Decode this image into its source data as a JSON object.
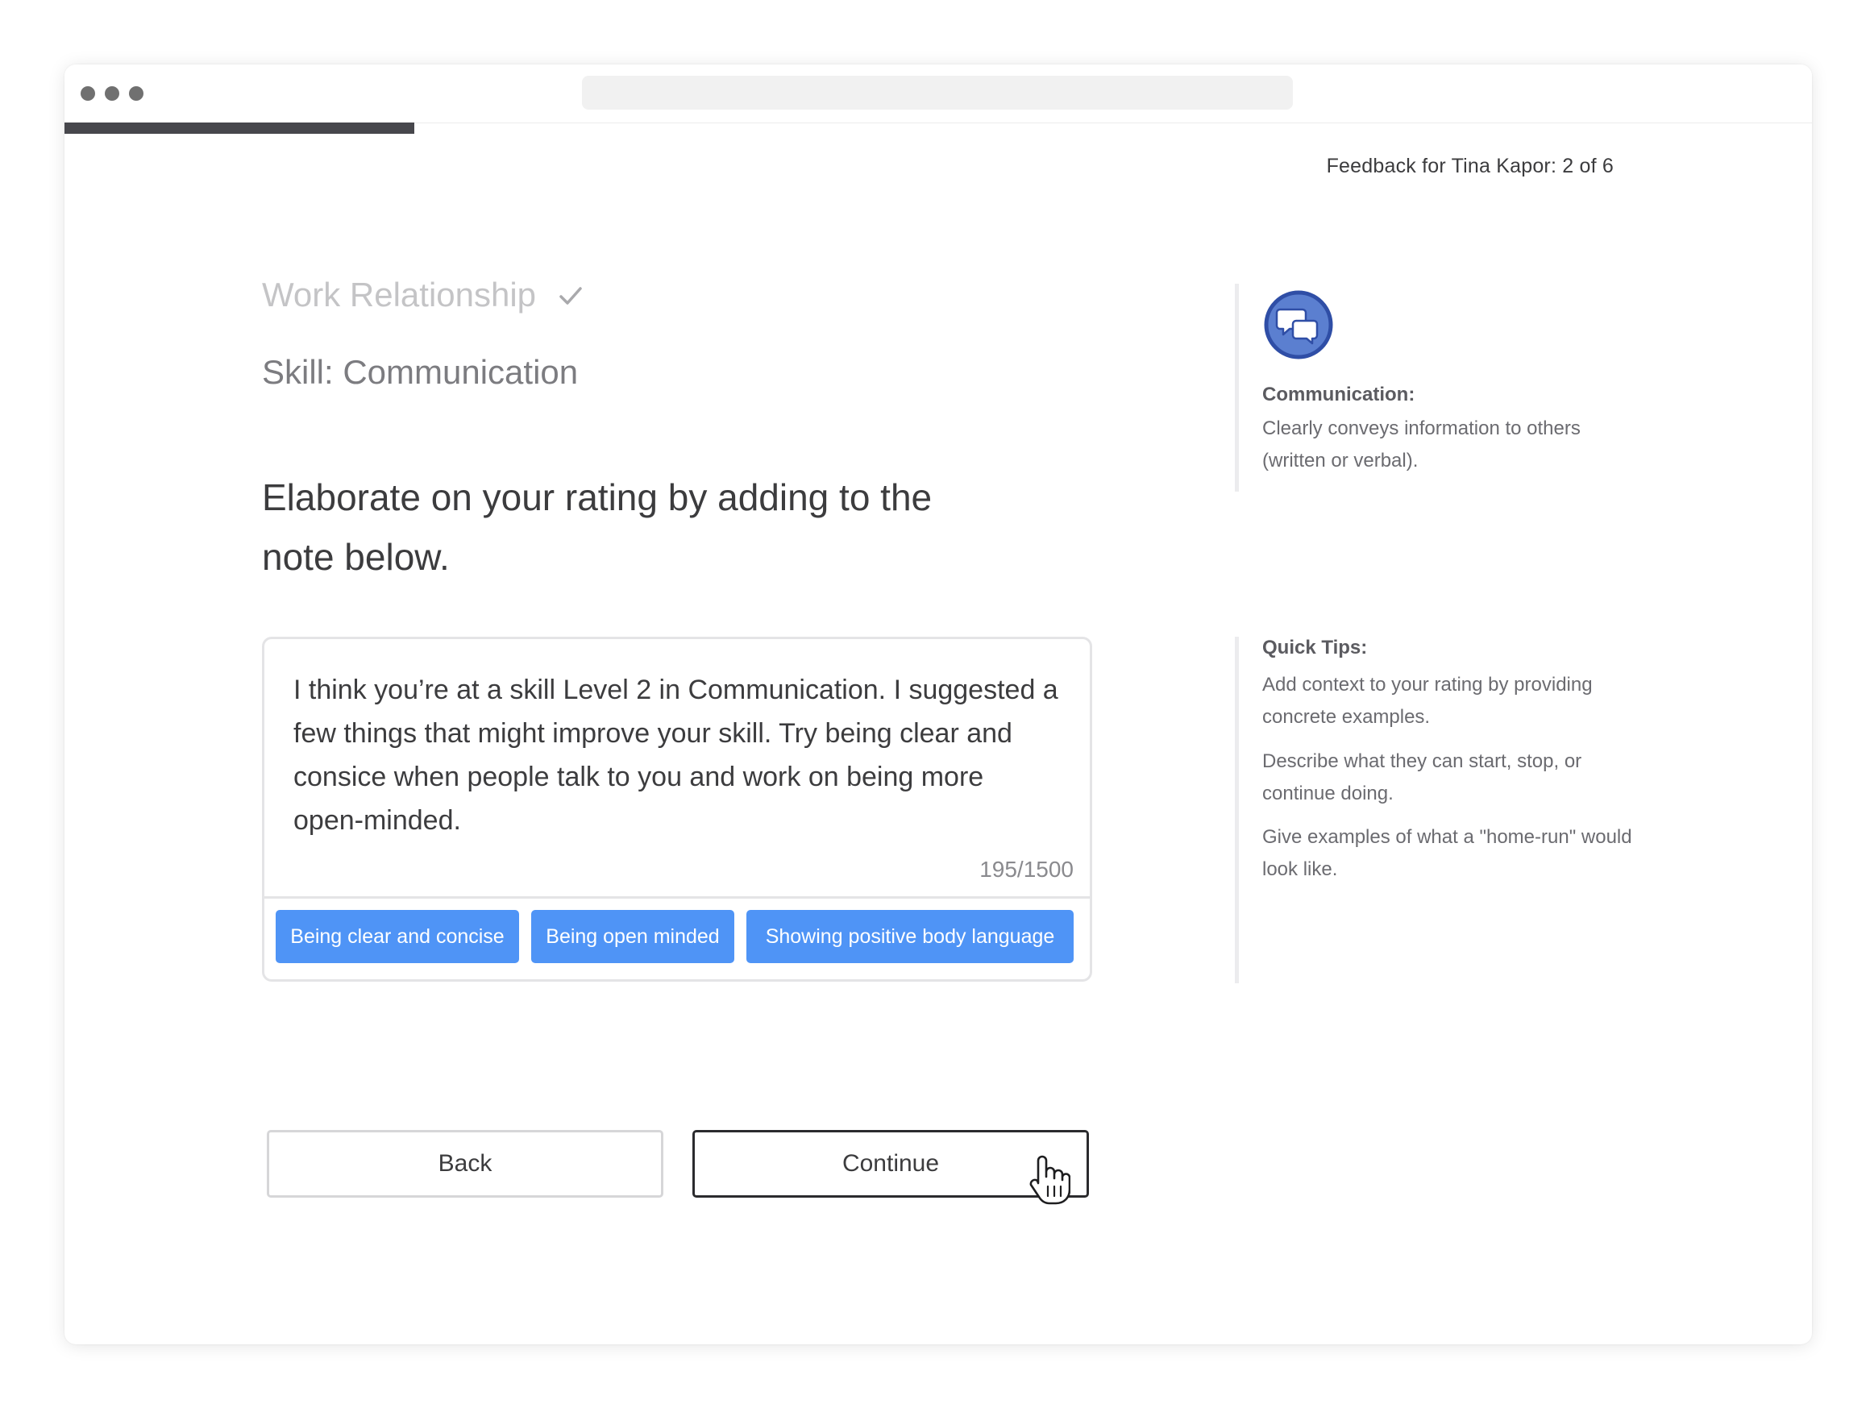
{
  "window": {
    "controls": [
      "window-dot",
      "window-dot",
      "window-dot"
    ]
  },
  "progress": {
    "value": 0.2
  },
  "header": {
    "feedback_counter": "Feedback for Tina Kapor: 2 of 6"
  },
  "main": {
    "section_title": "Work Relationship",
    "skill_label": "Skill: Communication",
    "prompt": "Elaborate on your rating by adding to the note below.",
    "note": {
      "text": "I think you’re at a skill Level 2 in Communication. I suggested a few things that might improve your skill. Try being clear and consice when people talk to you and work on being more open-minded.",
      "char_count": "195/1500"
    },
    "chips": [
      {
        "label": "Being clear and concise"
      },
      {
        "label": "Being open minded"
      },
      {
        "label": "Showing positive body language"
      }
    ],
    "buttons": {
      "back": "Back",
      "continue": "Continue"
    }
  },
  "sidebar": {
    "skill": {
      "icon": "speech-bubbles-icon",
      "heading": "Communication:",
      "description": "Clearly conveys information to others (written or verbal)."
    },
    "tips": {
      "heading": "Quick Tips:",
      "items": [
        "Add context to your rating by providing concrete examples.",
        "Describe what they can start, stop, or continue doing.",
        "Give examples of what a \"home-run\" would look like."
      ]
    }
  },
  "colors": {
    "accent": "#4f94f6",
    "icon_fill": "#5b7fd0",
    "icon_border": "#2f4ea6"
  }
}
